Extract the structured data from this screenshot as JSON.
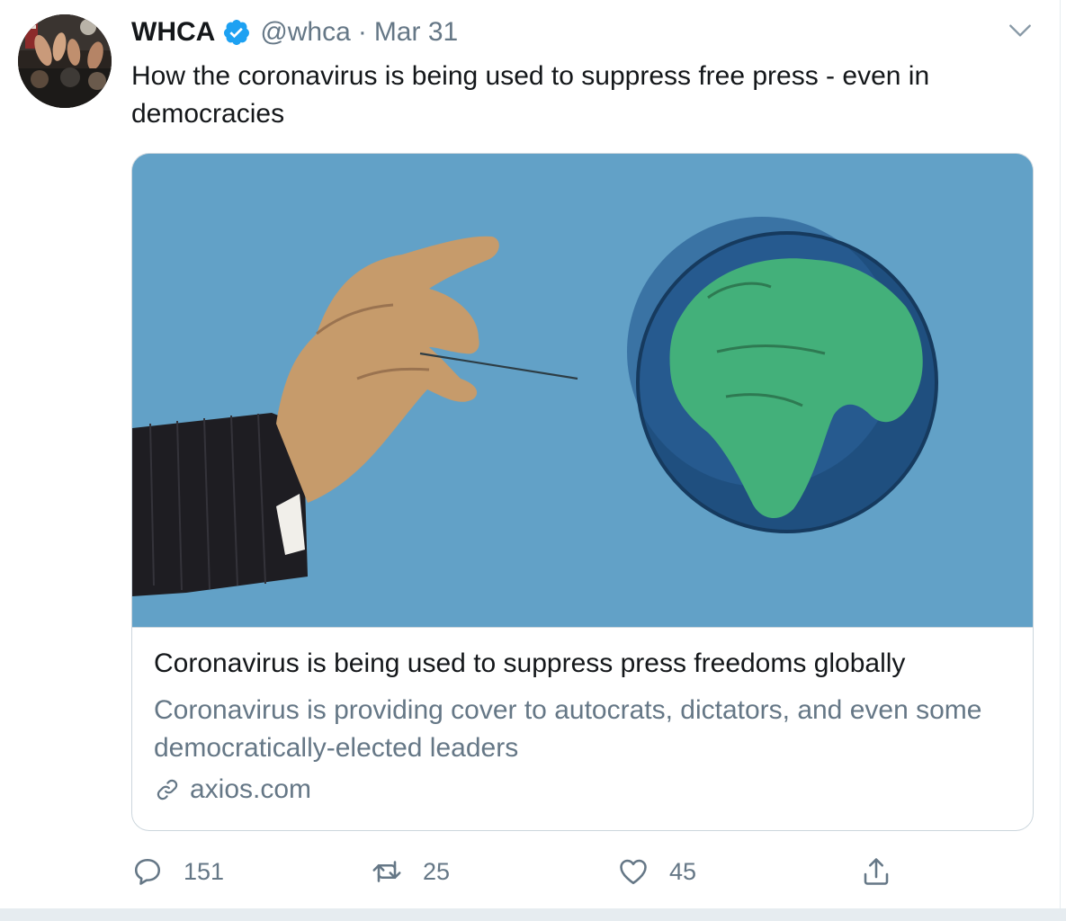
{
  "tweet": {
    "author": {
      "display_name": "WHCA",
      "handle": "@whca",
      "verified": true
    },
    "separator": "·",
    "date": "Mar 31",
    "text": "How the coronavirus is being used to suppress free press - even in democracies",
    "card": {
      "title": "Coronavirus is being used to suppress press freedoms globally",
      "description": "Coronavirus is providing cover to autocrats, dictators, and even some democratically-elected leaders",
      "domain": "axios.com"
    },
    "actions": {
      "replies": "151",
      "retweets": "25",
      "likes": "45"
    }
  },
  "icons": {
    "verified": "verified-badge-icon",
    "caret": "chevron-down-icon",
    "link": "link-icon",
    "reply": "reply-icon",
    "retweet": "retweet-icon",
    "like": "heart-icon",
    "share": "share-icon"
  },
  "colors": {
    "accent": "#1da1f2",
    "secondary_text": "#657786",
    "border": "#ccd6dd",
    "card_image_bg": "#62a1c7"
  }
}
